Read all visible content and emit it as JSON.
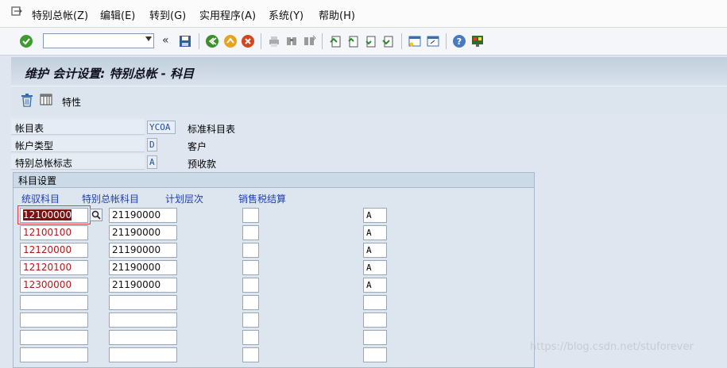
{
  "menubar": {
    "items": [
      "特别总帐(Z)",
      "编辑(E)",
      "转到(G)",
      "实用程序(A)",
      "系统(Y)",
      "帮助(H)"
    ]
  },
  "toolbar": {
    "command_field_value": "",
    "collapse_glyph": "«",
    "icons": [
      "enter-icon",
      "save-icon",
      "back-icon",
      "exit-icon",
      "cancel-icon",
      "print-icon",
      "find-icon",
      "find-next-icon",
      "first-page-icon",
      "previous-page-icon",
      "next-page-icon",
      "last-page-icon",
      "create-session-icon",
      "shortcut-icon",
      "help-icon",
      "layout-icon"
    ]
  },
  "title": "维护 会计设置: 特别总帐 - 科目",
  "app_toolbar": {
    "attributes_label": "特性"
  },
  "header": {
    "chart_of_accounts": {
      "label": "帐目表",
      "value": "YCOA",
      "description": "标准科目表"
    },
    "account_type": {
      "label": "帐户类型",
      "value": "D",
      "description": "客户"
    },
    "special_gl": {
      "label": "特别总帐标志",
      "value": "A",
      "description": "预收款"
    }
  },
  "group": {
    "title": "科目设置",
    "columns": {
      "recon_account": "统驭科目",
      "special_gl_account": "特别总帐科目",
      "planning_level": "计划层次",
      "tax_clearing": "销售税结算"
    },
    "rows": [
      {
        "recon": "12100000",
        "sgl": "21190000",
        "plan": "",
        "tax": "A"
      },
      {
        "recon": "12100100",
        "sgl": "21190000",
        "plan": "",
        "tax": "A"
      },
      {
        "recon": "12120000",
        "sgl": "21190000",
        "plan": "",
        "tax": "A"
      },
      {
        "recon": "12120100",
        "sgl": "21190000",
        "plan": "",
        "tax": "A"
      },
      {
        "recon": "12300000",
        "sgl": "21190000",
        "plan": "",
        "tax": "A"
      },
      {
        "recon": "",
        "sgl": "",
        "plan": "",
        "tax": ""
      },
      {
        "recon": "",
        "sgl": "",
        "plan": "",
        "tax": ""
      },
      {
        "recon": "",
        "sgl": "",
        "plan": "",
        "tax": ""
      },
      {
        "recon": "",
        "sgl": "",
        "plan": "",
        "tax": ""
      }
    ]
  },
  "watermark": "https://blog.csdn.net/stuforever",
  "colors": {
    "accent_blue": "#1f3fb0",
    "account_red": "#b01818",
    "selection": "#7c1212"
  }
}
